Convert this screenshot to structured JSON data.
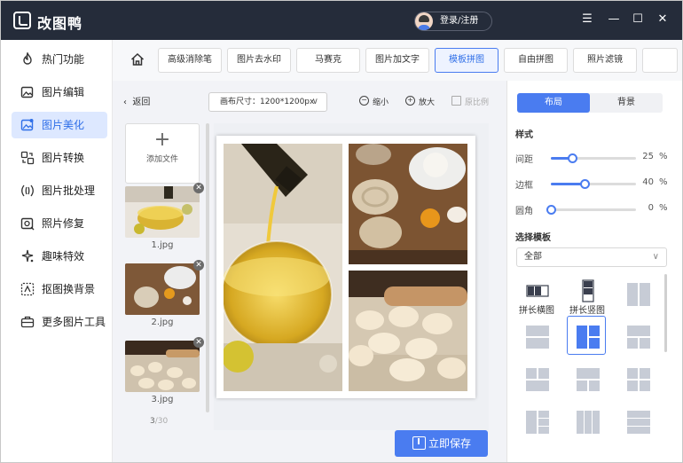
{
  "app": {
    "title": "改图鸭",
    "login_label": "登录/注册"
  },
  "window_controls": {
    "menu": "☰",
    "minimize": "—",
    "maximize": "☐",
    "close": "✕"
  },
  "sidebar": {
    "items": [
      {
        "label": "热门功能",
        "icon": "fire-icon",
        "active": false
      },
      {
        "label": "图片编辑",
        "icon": "image-edit-icon",
        "active": false
      },
      {
        "label": "图片美化",
        "icon": "image-beautify-icon",
        "active": true
      },
      {
        "label": "图片转换",
        "icon": "convert-icon",
        "active": false
      },
      {
        "label": "图片批处理",
        "icon": "batch-icon",
        "active": false
      },
      {
        "label": "照片修复",
        "icon": "repair-icon",
        "active": false
      },
      {
        "label": "趣味特效",
        "icon": "sparkle-icon",
        "active": false
      },
      {
        "label": "抠图换背景",
        "icon": "cutout-icon",
        "active": false
      },
      {
        "label": "更多图片工具",
        "icon": "toolbox-icon",
        "active": false
      }
    ]
  },
  "tabs": [
    {
      "label": "高级消除笔",
      "active": false
    },
    {
      "label": "图片去水印",
      "active": false
    },
    {
      "label": "马赛克",
      "active": false
    },
    {
      "label": "图片加文字",
      "active": false
    },
    {
      "label": "模板拼图",
      "active": true
    },
    {
      "label": "自由拼图",
      "active": false
    },
    {
      "label": "照片滤镜",
      "active": false
    }
  ],
  "left_panel": {
    "back_label": "返回",
    "add_file_label": "添加文件",
    "thumbnails": [
      {
        "name": "1.jpg"
      },
      {
        "name": "2.jpg"
      },
      {
        "name": "3.jpg"
      }
    ],
    "count_current": "3",
    "count_total": "/30"
  },
  "canvas_header": {
    "size_label": "画布尺寸：1200*1200px",
    "zoom_out_label": "缩小",
    "zoom_in_label": "放大",
    "original_ratio_label": "原比例"
  },
  "save_label": "立即保存",
  "right_panel": {
    "tabs": [
      {
        "label": "布局",
        "active": true
      },
      {
        "label": "背景",
        "active": false
      }
    ],
    "style_heading": "样式",
    "sliders": [
      {
        "label": "间距",
        "value": 25,
        "unit": "%"
      },
      {
        "label": "边框",
        "value": 40,
        "unit": "%"
      },
      {
        "label": "圆角",
        "value": 0,
        "unit": "%"
      }
    ],
    "template_heading": "选择模板",
    "template_filter": "全部",
    "templates": [
      {
        "label": "拼长横图",
        "icon": "long-horizontal-icon"
      },
      {
        "label": "拼长竖图",
        "icon": "long-vertical-icon"
      },
      {
        "label": "",
        "icon": "two-column-layout-icon"
      },
      {
        "label": "",
        "icon": "two-row-layout-icon"
      },
      {
        "label": "",
        "icon": "one-plus-two-layout-icon",
        "selected": true
      },
      {
        "label": "",
        "icon": "two-row-layout-icon"
      },
      {
        "label": "",
        "icon": "grid-layout-icon"
      },
      {
        "label": "",
        "icon": "grid-layout-icon"
      },
      {
        "label": "",
        "icon": "grid-layout-icon"
      },
      {
        "label": "",
        "icon": "grid-layout-icon"
      },
      {
        "label": "",
        "icon": "grid-layout-icon"
      },
      {
        "label": "",
        "icon": "grid-layout-icon"
      }
    ]
  },
  "colors": {
    "accent": "#4a7cf0",
    "titlebar": "#252c3a",
    "active_bg": "#dde8ff"
  }
}
